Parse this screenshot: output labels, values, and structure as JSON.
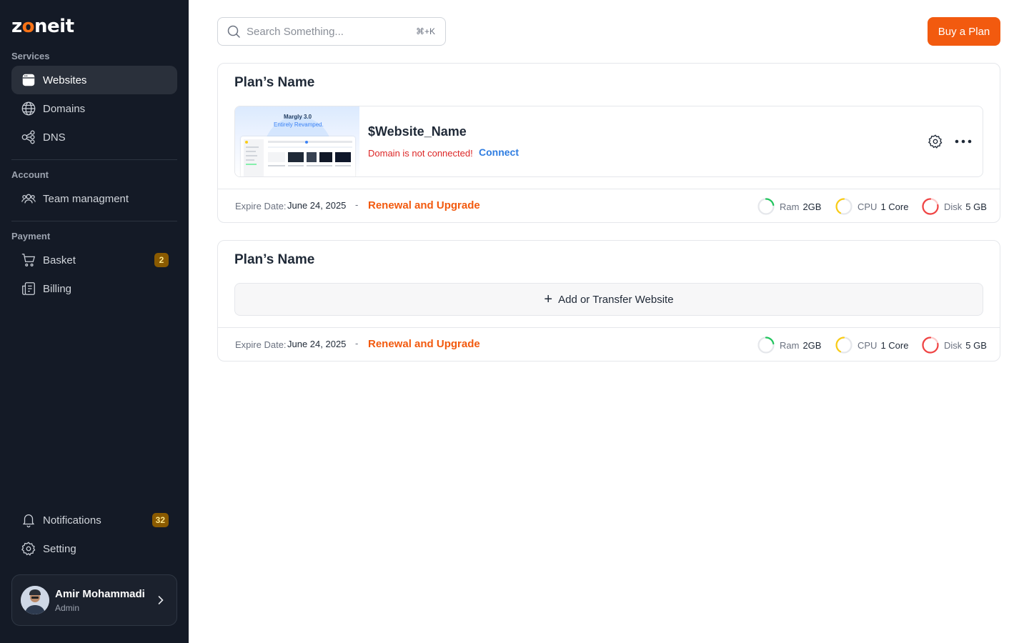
{
  "brand": {
    "logo_pre": "z",
    "logo_o": "o",
    "logo_post": "neit",
    "accent": "#f25a0f"
  },
  "sidebar": {
    "sections": [
      {
        "label": "Services"
      },
      {
        "label": "Account"
      },
      {
        "label": "Payment"
      }
    ],
    "items": [
      {
        "label": "Websites",
        "icon": "browser-icon",
        "active": true
      },
      {
        "label": "Domains",
        "icon": "globe-icon"
      },
      {
        "label": "DNS",
        "icon": "dns-nodes-icon"
      },
      {
        "label": "Team managment",
        "icon": "team-icon"
      },
      {
        "label": "Basket",
        "icon": "cart-icon",
        "badge": "2"
      },
      {
        "label": "Billing",
        "icon": "billing-icon"
      },
      {
        "label": "Notifications",
        "icon": "bell-icon",
        "badge": "32"
      },
      {
        "label": "Setting",
        "icon": "gear-icon"
      }
    ],
    "profile": {
      "name": "Amir Mohammadi",
      "role": "Admin"
    }
  },
  "search": {
    "placeholder": "Search Something...",
    "shortcut": "⌘+K"
  },
  "header": {
    "buy_label": "Buy a Plan"
  },
  "plans": [
    {
      "title": "Plan’s Name",
      "website": {
        "name": "$Website_Name",
        "status": "Domain is not connected!",
        "connect_label": "Connect",
        "thumb_title": "Margly 3.0",
        "thumb_subtitle": "Entirely Revamped."
      },
      "expire_label": "Expire Date:",
      "expire_date": "June 24, 2025",
      "separator": "-",
      "renew_label": "Renewal and Upgrade",
      "resources": [
        {
          "label": "Ram",
          "value": "2GB",
          "color": "#22c55e"
        },
        {
          "label": "CPU",
          "value": "1 Core",
          "color": "#facc15"
        },
        {
          "label": "Disk",
          "value": "5 GB",
          "color": "#ef4444"
        }
      ]
    },
    {
      "title": "Plan’s Name",
      "add_label": "Add or Transfer Website",
      "expire_label": "Expire Date:",
      "expire_date": "June 24, 2025",
      "separator": "-",
      "renew_label": "Renewal and Upgrade",
      "resources": [
        {
          "label": "Ram",
          "value": "2GB",
          "color": "#22c55e"
        },
        {
          "label": "CPU",
          "value": "1 Core",
          "color": "#facc15"
        },
        {
          "label": "Disk",
          "value": "5 GB",
          "color": "#ef4444"
        }
      ]
    }
  ]
}
